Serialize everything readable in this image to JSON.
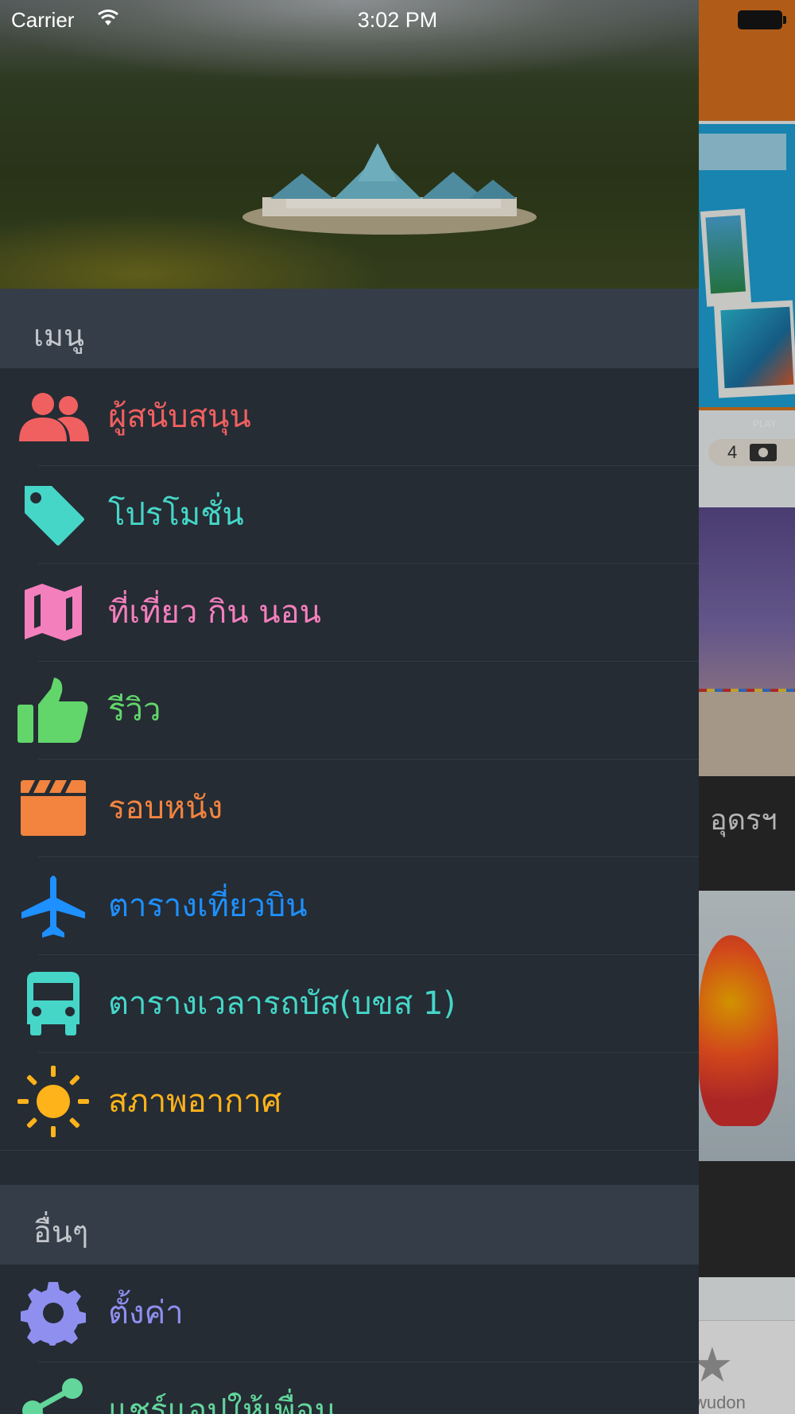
{
  "status_bar": {
    "carrier": "Carrier",
    "time": "3:02 PM"
  },
  "menu_section": {
    "title": "เมนู",
    "items": [
      {
        "label": "ผู้สนับสนุน",
        "icon": "people-icon",
        "color": "#f06060"
      },
      {
        "label": "โปรโมชั่น",
        "icon": "tag-icon",
        "color": "#45d6c8"
      },
      {
        "label": "ที่เที่ยว กิน นอน",
        "icon": "map-icon",
        "color": "#f47fbd"
      },
      {
        "label": "รีวิว",
        "icon": "thumbs-up-icon",
        "color": "#62d66b"
      },
      {
        "label": "รอบหนัง",
        "icon": "clapperboard-icon",
        "color": "#f2843f"
      },
      {
        "label": "ตารางเที่ยวบิน",
        "icon": "airplane-icon",
        "color": "#1e90ff"
      },
      {
        "label": "ตารางเวลารถบัส(บขส 1)",
        "icon": "bus-icon",
        "color": "#45d6c8"
      },
      {
        "label": "สภาพอากาศ",
        "icon": "sun-icon",
        "color": "#ffb31a"
      }
    ]
  },
  "other_section": {
    "title": "อื่นๆ",
    "items": [
      {
        "label": "ตั้งค่า",
        "icon": "gear-icon",
        "color": "#8f8ff0"
      },
      {
        "label": "แชร์แอปให้เพื่อน",
        "icon": "share-icon",
        "color": "#62d69b"
      }
    ]
  },
  "background_app": {
    "banner_play_text": "PLAY",
    "photo_count": "4",
    "caption_fragment": "อุดรฯ",
    "tab_label_fragment": "wudon"
  }
}
